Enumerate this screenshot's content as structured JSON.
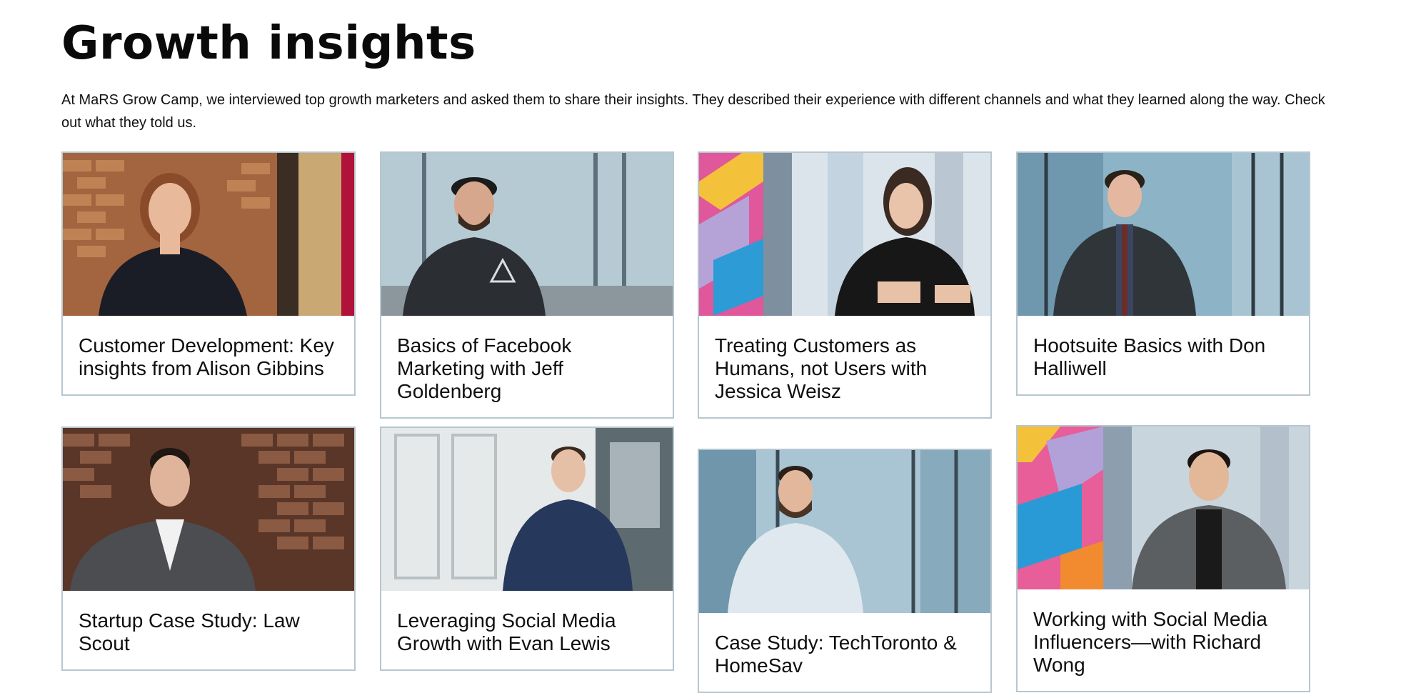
{
  "heading": "Growth insights",
  "intro": "At MaRS Grow Camp, we interviewed top growth marketers and asked them to share their insights. They described their experience with different channels and what they learned along the way. Check out what they told us.",
  "cards": [
    {
      "title": "Customer Development: Key insights from Alison Gibbins",
      "thumb_theme": "brick-warm"
    },
    {
      "title": "Basics of Facebook Marketing with Jeff Goldenberg",
      "thumb_theme": "office-window"
    },
    {
      "title": "Treating Customers as Humans, not Users with Jessica Weisz",
      "thumb_theme": "colorful-mural"
    },
    {
      "title": "Hootsuite Basics with Don Halliwell",
      "thumb_theme": "office-window"
    },
    {
      "title": "Startup Case Study: Law Scout",
      "thumb_theme": "brick-dark"
    },
    {
      "title": "Leveraging Social Media Growth with Evan Lewis",
      "thumb_theme": "bright-window"
    },
    {
      "title": "Case Study: TechToronto & HomeSav",
      "thumb_theme": "office-window"
    },
    {
      "title": "Working with Social Media Influencers—with Richard Wong",
      "thumb_theme": "colorful-mural"
    }
  ],
  "colors": {
    "card_border": "#b7c6cf",
    "heading": "#0a0a0a",
    "text": "#111111"
  }
}
